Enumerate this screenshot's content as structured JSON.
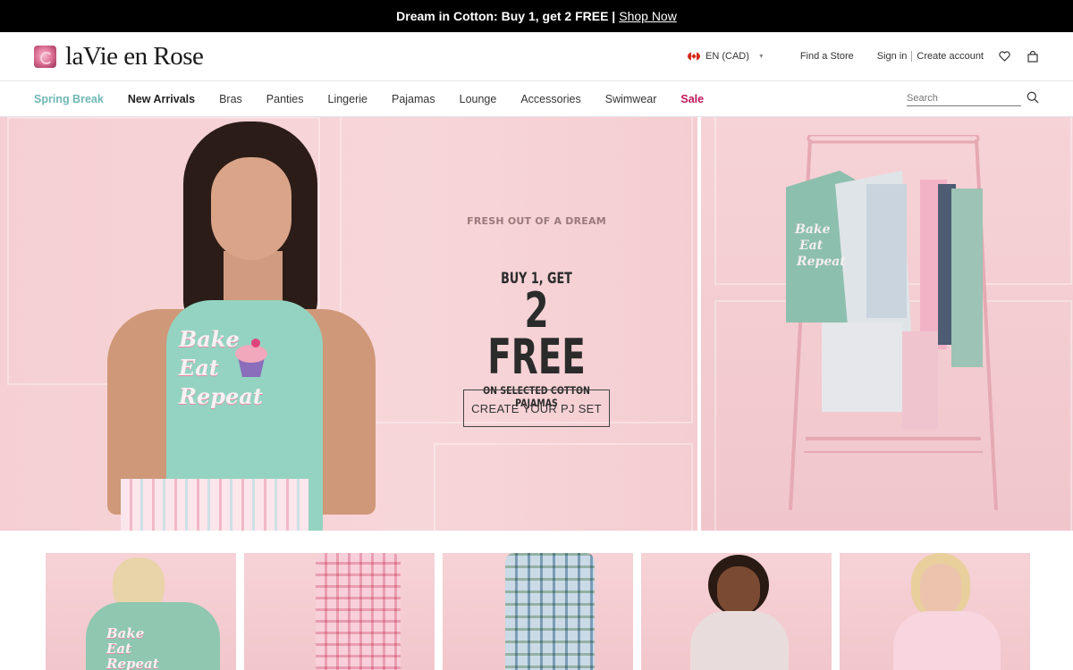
{
  "promo": {
    "text": "Dream in Cotton: Buy 1, get 2 FREE | ",
    "link": "Shop Now"
  },
  "header": {
    "brand": "laVie en Rose",
    "language": "EN (CAD)",
    "find_store": "Find a Store",
    "sign_in": "Sign in",
    "create_account": "Create account"
  },
  "nav": {
    "items": [
      "Spring Break",
      "New Arrivals",
      "Bras",
      "Panties",
      "Lingerie",
      "Pajamas",
      "Lounge",
      "Accessories",
      "Swimwear",
      "Sale"
    ],
    "search_placeholder": "Search"
  },
  "hero": {
    "kicker": "FRESH OUT OF A DREAM",
    "buy": "BUY 1, GET",
    "free": "2 FREE",
    "sub": "ON SELECTED COTTON PAJAMAS",
    "cta": "CREATE YOUR PJ SET",
    "tank_text": [
      "Bake",
      "Eat",
      "Repeat"
    ]
  },
  "products": [
    {
      "tank_text": [
        "Bake",
        "Eat",
        "Repeat"
      ]
    },
    {},
    {},
    {},
    {}
  ],
  "colors": {
    "accent_teal": "#6fb7b4",
    "sale": "#c2185b",
    "hero_pink": "#f5cfd3"
  }
}
